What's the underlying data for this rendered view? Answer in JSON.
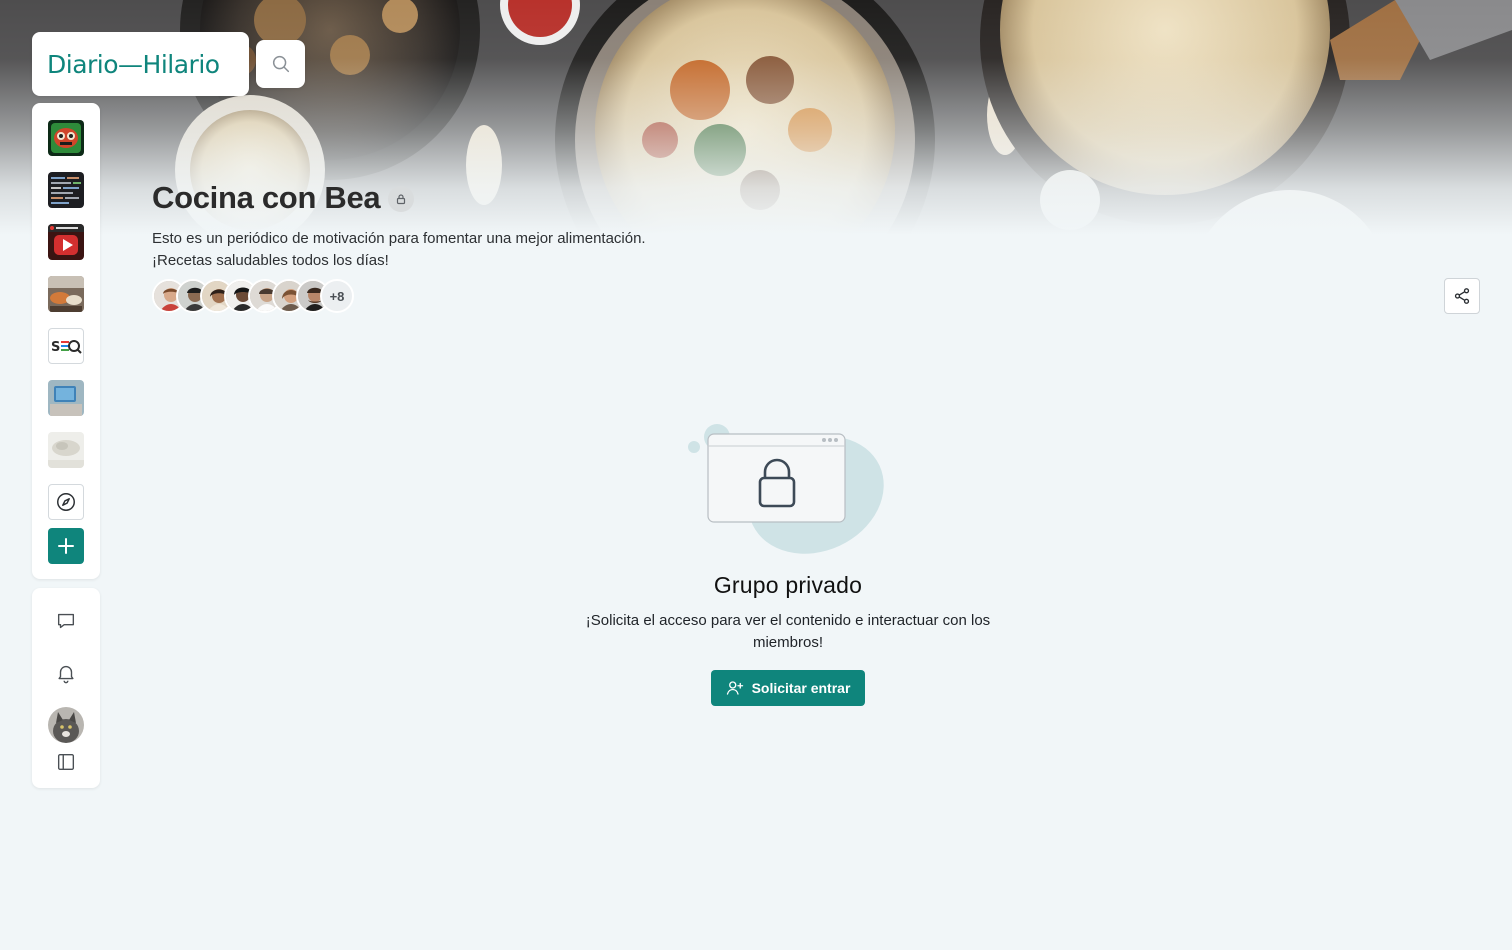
{
  "brand": {
    "name": "Diario—Hilario"
  },
  "search": {
    "icon": "search-icon"
  },
  "group": {
    "title": "Cocina con Bea",
    "description_line1": "Esto es un periódico de motivación para fomentar una mejor alimentación.",
    "description_line2": "¡Recetas saludables todos los días!",
    "members_more": "+8"
  },
  "private_group": {
    "title": "Grupo privado",
    "message": "¡Solicita el acceso para ver el contenido e interactuar con los miembros!",
    "button_label": "Solicitar entrar"
  },
  "rail": {
    "items": [
      "community-1",
      "community-2",
      "community-youtube",
      "community-4",
      "community-seo",
      "community-6",
      "community-7"
    ],
    "explore": "compass-icon",
    "add": "plus-icon",
    "messages": "chat-icon",
    "notifications": "bell-icon",
    "sidebar_toggle": "sidebar-icon"
  },
  "colors": {
    "accent": "#0f857c",
    "background": "#f1f6f8"
  }
}
